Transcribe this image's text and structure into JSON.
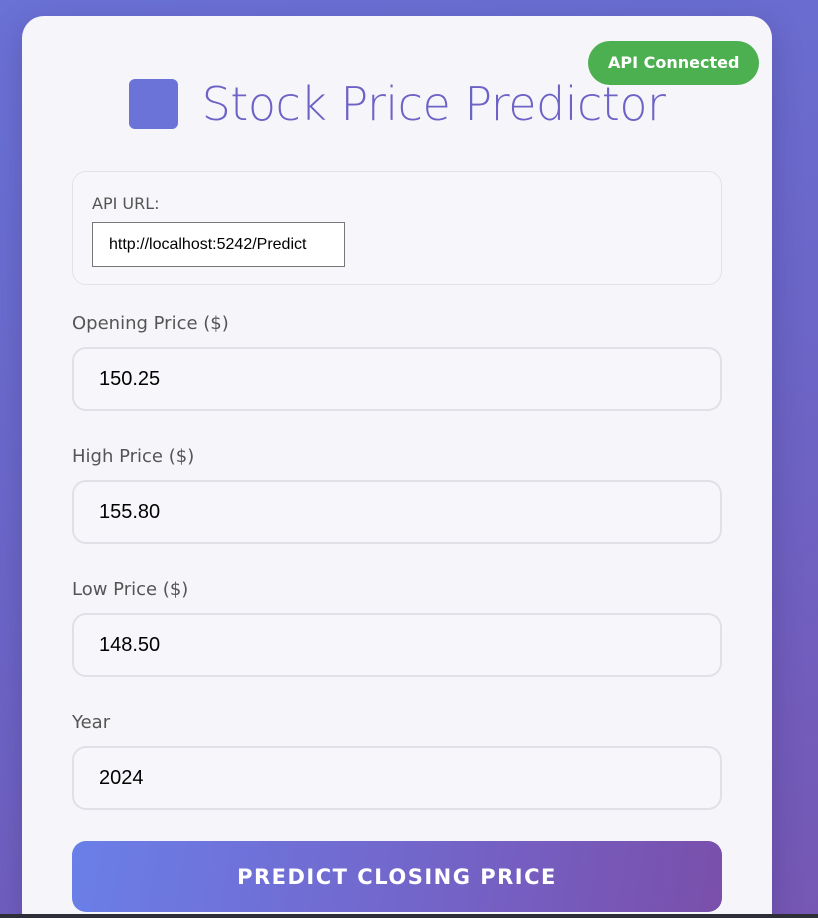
{
  "header": {
    "title": "Stock Price Predictor",
    "logo_icon": "square-logo-icon",
    "status_badge": "API Connected",
    "status_color": "#4caf50"
  },
  "api_config": {
    "label": "API URL:",
    "value": "http://localhost:5242/Predict"
  },
  "form": {
    "fields": [
      {
        "label": "Opening Price ($)",
        "value": "150.25"
      },
      {
        "label": "High Price ($)",
        "value": "155.80"
      },
      {
        "label": "Low Price ($)",
        "value": "148.50"
      },
      {
        "label": "Year",
        "value": "2024"
      }
    ],
    "submit_label": "PREDICT CLOSING PRICE"
  },
  "colors": {
    "accent": "#6b72d8",
    "title": "#6d62c6",
    "button_gradient_start": "#6a7fe8",
    "button_gradient_end": "#7a4fab"
  }
}
